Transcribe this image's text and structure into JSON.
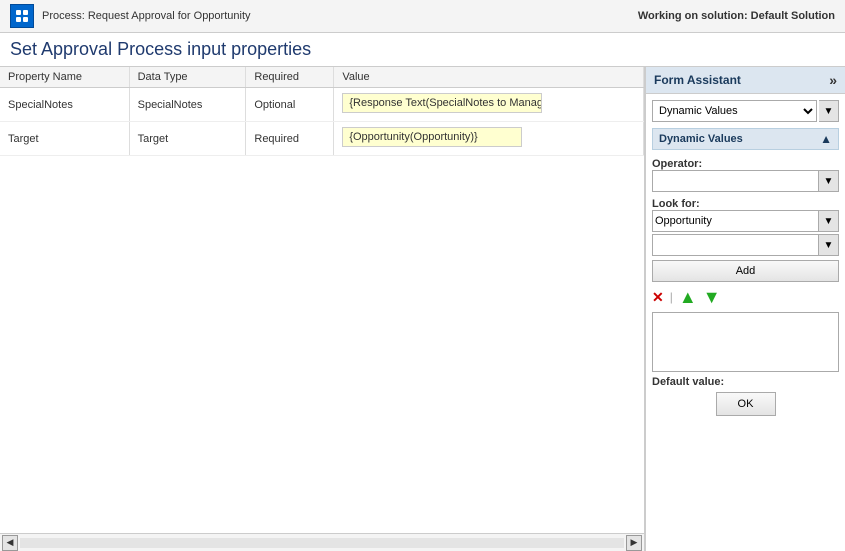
{
  "topbar": {
    "breadcrumb": "Process: Request Approval for Opportunity",
    "solution_label": "Working on solution: Default Solution",
    "icon_alt": "process-icon"
  },
  "page": {
    "title": "Set Approval Process input properties"
  },
  "table": {
    "headers": [
      "Property Name",
      "Data Type",
      "Required",
      "Value"
    ],
    "rows": [
      {
        "property_name": "SpecialNotes",
        "data_type": "SpecialNotes",
        "required": "Optional",
        "value": "{Response Text(SpecialNotes to Manage"
      },
      {
        "property_name": "Target",
        "data_type": "Target",
        "required": "Required",
        "value": "{Opportunity(Opportunity)}"
      }
    ]
  },
  "form_assistant": {
    "title": "Form Assistant",
    "expand_icon": "»",
    "dropdown_label": "Dynamic Values",
    "section_title": "Dynamic Values",
    "operator_label": "Operator:",
    "operator_value": "",
    "look_for_label": "Look for:",
    "look_for_value": "Opportunity",
    "look_for_sub_value": "",
    "add_button": "Add",
    "delete_icon": "✕",
    "up_icon": "▲",
    "down_icon": "▼",
    "default_value_label": "Default value:",
    "ok_button": "OK"
  },
  "scrollbar": {
    "left_arrow": "◀",
    "right_arrow": "▶"
  }
}
